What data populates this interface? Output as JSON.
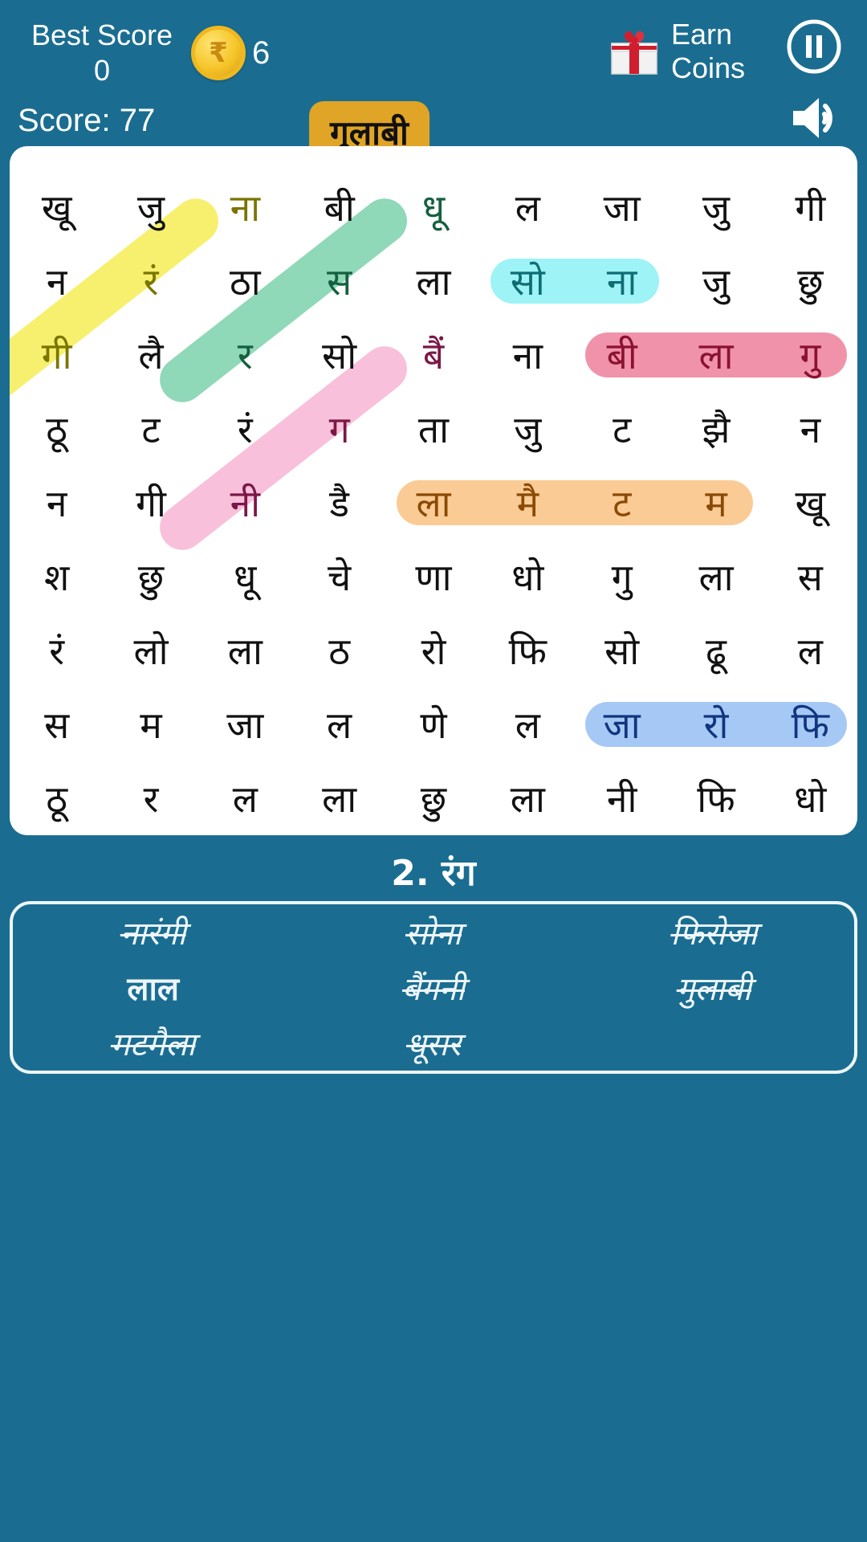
{
  "header": {
    "best_score_label": "Best Score",
    "best_score_value": "0",
    "coin_symbol": "₹",
    "coin_count": "6",
    "score_label": "Score: 77",
    "current_word": "गुलाबी",
    "earn_coins_label": "Earn\nCoins",
    "earn_coins_line1": "Earn",
    "earn_coins_line2": "Coins",
    "pause_icon": "pause-icon",
    "sound_icon": "speaker-icon",
    "gift_icon": "gift-box-icon",
    "coin_icon": "rupee-coin-icon"
  },
  "colors": {
    "background": "#1a6d91",
    "card": "#ffffff",
    "chip": "#e0a526",
    "hl_yellow": "#f7f06e",
    "hl_green": "#8fd8b8",
    "hl_pink": "#f8c0db",
    "hl_cyan": "#9df3f6",
    "hl_crimson": "#f093aa",
    "hl_orange": "#fbcb95",
    "hl_blue": "#a6c8f5"
  },
  "grid": {
    "rows": 10,
    "cols": 9,
    "letters": [
      [
        "खू",
        "जु",
        "ना",
        "बी",
        "धू",
        "ल",
        "जा",
        "जु",
        "गी"
      ],
      [
        "न",
        "रं",
        "ठा",
        "स",
        "ला",
        "सो",
        "ना",
        "जु",
        "छु"
      ],
      [
        "गी",
        "लै",
        "र",
        "सो",
        "बैं",
        "ना",
        "बी",
        "ला",
        "गु"
      ],
      [
        "ठू",
        "ट",
        "रं",
        "ग",
        "ता",
        "जु",
        "ट",
        "झै",
        "न"
      ],
      [
        "न",
        "गी",
        "नी",
        "डै",
        "ला",
        "मै",
        "ट",
        "म",
        "खू"
      ],
      [
        "श",
        "छु",
        "धू",
        "चे",
        "णा",
        "धो",
        "गु",
        "ला",
        "स"
      ],
      [
        "रं",
        "लो",
        "ला",
        "ठ",
        "रो",
        "फि",
        "सो",
        "ढू",
        "ल"
      ],
      [
        "स",
        "म",
        "जा",
        "ल",
        "णे",
        "ल",
        "जा",
        "रो",
        "फि"
      ],
      [
        "ठू",
        "र",
        "ल",
        "ला",
        "छु",
        "ला",
        "नी",
        "फि",
        "धो"
      ]
    ],
    "highlights": [
      {
        "word": "नारंगी",
        "color": "#f7f06e",
        "text_color": "#7a7500",
        "kind": "diagonal",
        "r1": 0,
        "c1": 2,
        "r2": 2,
        "c2": 0
      },
      {
        "word": "धूसर",
        "color": "#8fd8b8",
        "text_color": "#15603f",
        "kind": "diagonal",
        "r1": 0,
        "c1": 4,
        "r2": 2,
        "c2": 2
      },
      {
        "word": "बैंगनी",
        "color": "#f8c0db",
        "text_color": "#7a1847",
        "kind": "diagonal",
        "r1": 2,
        "c1": 4,
        "r2": 4,
        "c2": 2
      },
      {
        "word": "सोना",
        "color": "#9df3f6",
        "text_color": "#0f6e73",
        "kind": "horizontal",
        "row": 1,
        "c1": 5,
        "c2": 6
      },
      {
        "word": "गुलाबी",
        "color": "#f093aa",
        "text_color": "#8a1230",
        "kind": "horizontal",
        "row": 2,
        "c1": 6,
        "c2": 8
      },
      {
        "word": "मटमैला",
        "color": "#fbcb95",
        "text_color": "#8a4a06",
        "kind": "horizontal",
        "row": 4,
        "c1": 4,
        "c2": 7
      },
      {
        "word": "फिरोजा",
        "color": "#a6c8f5",
        "text_color": "#11357e",
        "kind": "horizontal",
        "row": 7,
        "c1": 6,
        "c2": 8
      }
    ]
  },
  "word_list": {
    "title": "2. रंग",
    "items": [
      {
        "label": "नारंगी",
        "found": true
      },
      {
        "label": "सोना",
        "found": true
      },
      {
        "label": "फिरोजा",
        "found": true
      },
      {
        "label": "लाल",
        "found": false
      },
      {
        "label": "बैंगनी",
        "found": true
      },
      {
        "label": "गुलाबी",
        "found": true
      },
      {
        "label": "मटमैला",
        "found": true
      },
      {
        "label": "धूसर",
        "found": true
      },
      {
        "label": "",
        "found": false
      }
    ]
  }
}
